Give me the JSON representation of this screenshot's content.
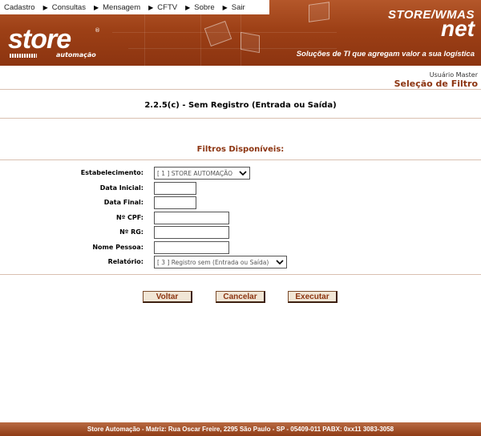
{
  "menu": {
    "items": [
      "Cadastro",
      "Consultas",
      "Mensagem",
      "CFTV",
      "Sobre",
      "Sair"
    ]
  },
  "header": {
    "logo_word": "store",
    "logo_reg": "®",
    "logo_sub": "automação",
    "brand_top": "STORE/WMAS",
    "brand_bottom": "net",
    "tagline": "Soluções de TI que agregam valor a sua logística"
  },
  "user": {
    "name": "Usuário Master",
    "section": "Seleção de Filtro"
  },
  "page": {
    "title": "2.2.5(c) - Sem Registro (Entrada ou Saída)",
    "filters_title": "Filtros Disponíveis:"
  },
  "form": {
    "estabelecimento": {
      "label": "Estabelecimento:",
      "value": "[ 1 ] STORE AUTOMAÇÃO"
    },
    "data_inicial": {
      "label": "Data Inicial:",
      "value": ""
    },
    "data_final": {
      "label": "Data Final:",
      "value": ""
    },
    "cpf": {
      "label": "Nº CPF:",
      "value": ""
    },
    "rg": {
      "label": "Nº RG:",
      "value": ""
    },
    "nome": {
      "label": "Nome Pessoa:",
      "value": ""
    },
    "relatorio": {
      "label": "Relatório:",
      "value": "[ 3 ] Registro sem (Entrada ou Saída)"
    }
  },
  "buttons": {
    "voltar": "Voltar",
    "cancelar": "Cancelar",
    "executar": "Executar"
  },
  "footer": {
    "text": "Store Automação - Matriz: Rua Oscar Freire, 2295 São Paulo - SP - 05409-011 PABX: 0xx11 3083-3058"
  },
  "colors": {
    "brand": "#9d4016",
    "accent_text": "#8c3410",
    "button_bg": "#f1e6d6"
  }
}
